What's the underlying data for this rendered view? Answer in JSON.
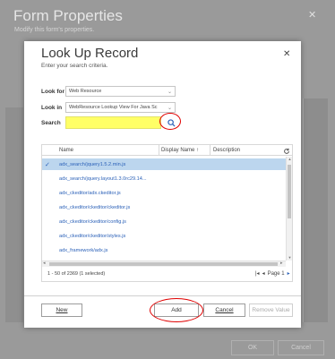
{
  "background_dialog": {
    "title": "Form Properties",
    "subtitle": "Modify this form's properties.",
    "close_glyph": "✕",
    "ok_label": "OK",
    "cancel_label": "Cancel"
  },
  "lookup_dialog": {
    "title": "Look Up Record",
    "subtitle": "Enter your search criteria.",
    "close_glyph": "✕",
    "look_for_label": "Look for",
    "look_for_value": "Web Resource",
    "look_in_label": "Look in",
    "look_in_value": "WebResource Lookup View For Java Sc",
    "search_label": "Search",
    "search_value": "",
    "search_icon": "magnifier-icon"
  },
  "grid": {
    "columns": [
      "Name",
      "Display Name ↑",
      "Description"
    ],
    "rows": [
      {
        "name": "adx_search/jquery1.5.2.min.js",
        "selected": true
      },
      {
        "name": "adx_search/jquery.layout1.3.0rc29.14...",
        "selected": false
      },
      {
        "name": "adx_ckeditor/adx.ckeditor.js",
        "selected": false
      },
      {
        "name": "adx_ckeditor/ckeditor/ckeditor.js",
        "selected": false
      },
      {
        "name": "adx_ckeditor/ckeditor/config.js",
        "selected": false
      },
      {
        "name": "adx_ckeditor/ckeditor/styles.js",
        "selected": false
      },
      {
        "name": "adx_framework/adx.js",
        "selected": false
      }
    ],
    "status": "1 - 50 of 2369 (1 selected)",
    "page_label": "Page 1"
  },
  "buttons": {
    "new": "New",
    "add": "Add",
    "cancel": "Cancel",
    "remove": "Remove Value"
  },
  "colors": {
    "highlight": "#ffff66",
    "annotation": "#e00000",
    "link": "#2b61b8",
    "selected_row": "#bcd6ee"
  }
}
